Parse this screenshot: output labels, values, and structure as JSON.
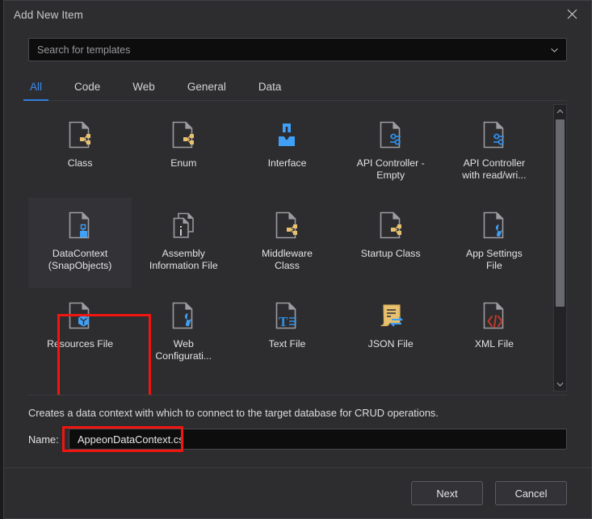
{
  "window": {
    "title": "Add New Item",
    "close_icon": "close-icon"
  },
  "search": {
    "placeholder": "Search for templates",
    "value": "",
    "chevron_icon": "chevron-down-icon"
  },
  "tabs": [
    {
      "label": "All",
      "active": true
    },
    {
      "label": "Code",
      "active": false
    },
    {
      "label": "Web",
      "active": false
    },
    {
      "label": "General",
      "active": false
    },
    {
      "label": "Data",
      "active": false
    }
  ],
  "templates": [
    {
      "label": "Class",
      "icon": "class-file-icon",
      "selected": false
    },
    {
      "label": "Enum",
      "icon": "enum-file-icon",
      "selected": false
    },
    {
      "label": "Interface",
      "icon": "interface-icon",
      "selected": false
    },
    {
      "label": "API Controller -\nEmpty",
      "icon": "api-controller-icon",
      "selected": false
    },
    {
      "label": "API Controller\nwith read/wri...",
      "icon": "api-controller-icon",
      "selected": false
    },
    {
      "label": "DataContext\n(SnapObjects)",
      "icon": "datacontext-file-icon",
      "selected": true
    },
    {
      "label": "Assembly\nInformation File",
      "icon": "assembly-info-icon",
      "selected": false
    },
    {
      "label": "Middleware\nClass",
      "icon": "middleware-class-icon",
      "selected": false
    },
    {
      "label": "Startup Class",
      "icon": "startup-class-icon",
      "selected": false
    },
    {
      "label": "App Settings\nFile",
      "icon": "app-settings-icon",
      "selected": false
    },
    {
      "label": "Resources File",
      "icon": "resources-file-icon",
      "selected": false
    },
    {
      "label": "Web\nConfigurati...",
      "icon": "web-config-icon",
      "selected": false
    },
    {
      "label": "Text File",
      "icon": "text-file-icon",
      "selected": false
    },
    {
      "label": "JSON File",
      "icon": "json-file-icon",
      "selected": false
    },
    {
      "label": "XML File",
      "icon": "xml-file-icon",
      "selected": false
    }
  ],
  "description": "Creates a data context with which to connect to the target database for CRUD operations.",
  "name_field": {
    "label": "Name:",
    "value": "AppeonDataContext.cs"
  },
  "footer": {
    "next_label": "Next",
    "cancel_label": "Cancel"
  },
  "colors": {
    "accent": "#2f7fe0",
    "highlight_outline": "#f2150f",
    "dialog_bg": "#2d2d30",
    "input_bg": "#0d0d0e",
    "icon_blue": "#3fa0f5",
    "icon_yellow": "#e8c170",
    "icon_gray": "#9d9da1",
    "icon_red": "#c0392b"
  }
}
